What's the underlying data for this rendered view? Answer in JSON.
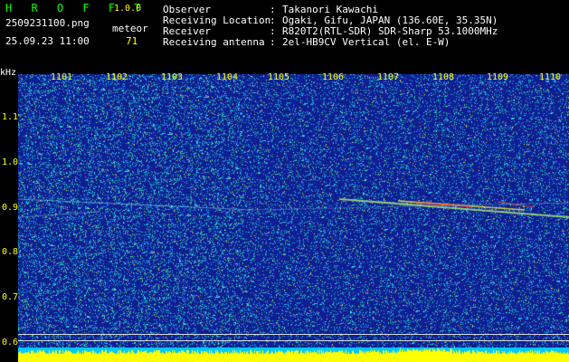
{
  "header": {
    "app_title": "H R O F F T",
    "app_version": "1.0.0",
    "filename": "2509231100.png",
    "datetime": "25.09.23 11:00",
    "meteor_label": "meteor",
    "meteor_count": "71"
  },
  "info": [
    {
      "key": "Observer",
      "sep": ":",
      "value": "Takanori Kawachi"
    },
    {
      "key": "Receiving Location",
      "sep": ":",
      "value": "Ogaki, Gifu, JAPAN (136.60E, 35.35N)"
    },
    {
      "key": "Receiver",
      "sep": ":",
      "value": "R820T2(RTL-SDR) SDR-Sharp 53.1000MHz"
    },
    {
      "key": "Receiving antenna",
      "sep": ":",
      "value": "2el-HB9CV Vertical (el. E-W)"
    }
  ],
  "axis": {
    "unit_label": "kHz",
    "x_ticks": [
      "1101",
      "1102",
      "1103",
      "1104",
      "1105",
      "1106",
      "1107",
      "1108",
      "1109",
      "1110"
    ],
    "y_ticks": [
      "1.1",
      "1.0",
      "0.9",
      "0.8",
      "0.7",
      "0.6"
    ]
  },
  "colors": {
    "background": "#000000",
    "spectrogram_base": "#1c2ea8",
    "label_yellow": "#ffff00",
    "title_green": "#00ff00",
    "bottom_bar_yellow": "#ffff00",
    "bottom_bar_cyan": "#00c8ff"
  }
}
